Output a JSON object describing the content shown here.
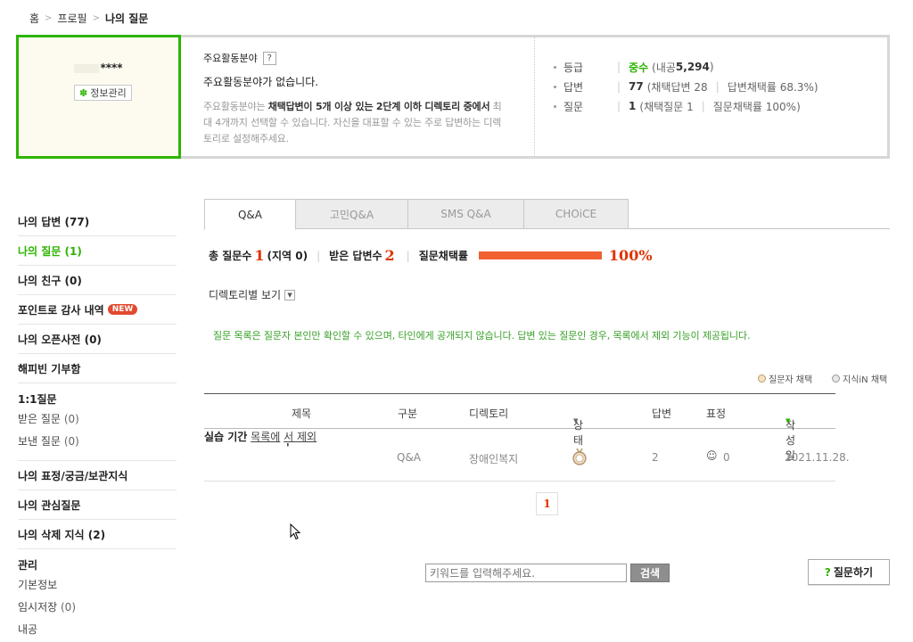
{
  "breadcrumb": {
    "home": "홈",
    "profile": "프로필",
    "current": "나의 질문"
  },
  "profile": {
    "nickname_suffix": "****",
    "edit_label": "정보관리",
    "area_heading": "주요활동분야",
    "area_help": "?",
    "area_main": "주요활동분야가 없습니다.",
    "area_desc_1": "주요활동분야는 ",
    "area_desc_2": "채택답변이 5개 이상 있는 2단계 이하 디렉토리 중에서",
    "area_desc_3": " 최대 4개까지 선택할 수 있습니다. 자신을 대표할 수 있는 주로 답변하는 디렉토리로 설정해주세요.",
    "stats": {
      "grade_label": "등급",
      "grade_value": "중수",
      "grade_extra_prefix": "(내공 ",
      "grade_points": "5,294",
      "grade_extra_suffix": ")",
      "answer_label": "답변",
      "answer_count": "77",
      "answer_adopted": "(채택답변 28",
      "answer_rate": "답변채택률 68.3%)",
      "question_label": "질문",
      "question_count": "1",
      "question_adopted": "(채택질문 1",
      "question_rate": "질문채택률 100%)"
    }
  },
  "sidebar": {
    "my_answers": "나의 답변 (77)",
    "my_questions": "나의 질문 (1)",
    "my_friends": "나의 친구 (0)",
    "point_thanks": "포인트로 감사 내역",
    "new_badge": "NEW",
    "open_dict": "나의 오픈사전 (0)",
    "happybean": "해피빈 기부함",
    "one_on_one": "1:1질문",
    "received_q": "받은 질문",
    "received_q_cnt": "(0)",
    "sent_q": "보낸 질문",
    "sent_q_cnt": "(0)",
    "emotions": "나의 표정/궁금/보관지식",
    "interests": "나의 관심질문",
    "deleted": "나의 삭제 지식 (2)",
    "manage": "관리",
    "basic_info": "기본정보",
    "temp_save": "임시저장",
    "temp_save_cnt": "(0)",
    "naegong": "내공"
  },
  "tabs": [
    "Q&A",
    "고민Q&A",
    "SMS Q&A",
    "CHOiCE"
  ],
  "summary": {
    "total_label": "총 질문수",
    "total_value": "1",
    "region_label": "(지역",
    "region_value": "0)",
    "received_label": "받은 답변수",
    "received_value": "2",
    "rate_label": "질문채택률",
    "rate_value": "100%",
    "rate_fraction": 1.0
  },
  "directory_filter": "디렉토리별 보기",
  "notice": "질문 목록은 질문자 본인만 확인할 수 있으며, 타인에게 공개되지 않습니다. 답변 있는 질문인 경우, 목록에서 제외 기능이 제공됩니다.",
  "legend": {
    "asker": "질문자 채택",
    "kin": "지식iN 채택"
  },
  "table": {
    "headers": {
      "title": "제목",
      "type": "구분",
      "directory": "디렉토리",
      "status": "상태",
      "answers": "답변",
      "emotion": "표정",
      "date": "작성일"
    },
    "rows": [
      {
        "title_tick": "'",
        "title": "실습 기간",
        "exclude_1": "목록에",
        "exclude_2": "서 제외",
        "type": "Q&A",
        "directory": "장애인복지",
        "status_icon": "medal-icon",
        "answers": "2",
        "emotion_count": "0",
        "date": "2021.11.28."
      }
    ]
  },
  "pagination": {
    "current": "1"
  },
  "search": {
    "placeholder": "키워드를 입력해주세요.",
    "button": "검색"
  },
  "ask_button": "질문하기",
  "colors": {
    "accent_green": "#2db400",
    "accent_red": "#e03300",
    "bar_orange": "#f06030"
  }
}
